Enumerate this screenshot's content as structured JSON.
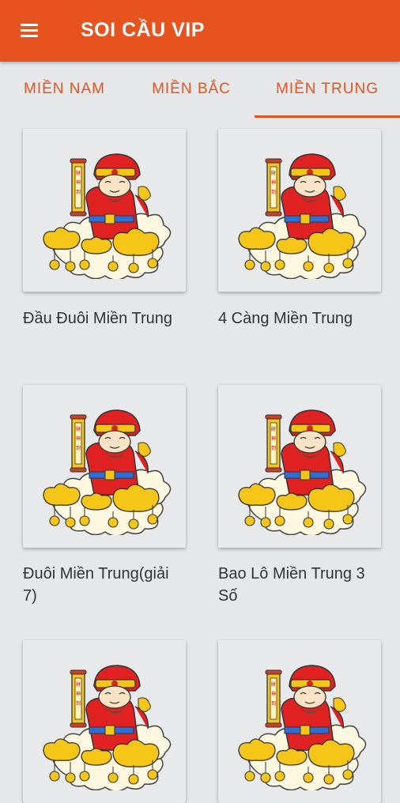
{
  "app": {
    "title": "SOI CẦU VIP",
    "menu_icon": "hamburger-menu-icon",
    "accent": "#e6531e"
  },
  "tabs": [
    {
      "label": "MIỀN NAM",
      "active": false
    },
    {
      "label": "MIỀN BẮC",
      "active": false
    },
    {
      "label": "MIỀN TRUNG",
      "active": true
    }
  ],
  "items": [
    {
      "label": "Đầu Đuôi Miền Trung",
      "icon": "god-of-wealth-image"
    },
    {
      "label": "4 Càng Miền Trung",
      "icon": "god-of-wealth-image"
    },
    {
      "label": "Đuôi Miền Trung(giải 7)",
      "icon": "god-of-wealth-image"
    },
    {
      "label": "Bao Lô Miền Trung 3 Số",
      "icon": "god-of-wealth-image"
    },
    {
      "label": "",
      "icon": "god-of-wealth-image"
    },
    {
      "label": "",
      "icon": "god-of-wealth-image"
    }
  ]
}
